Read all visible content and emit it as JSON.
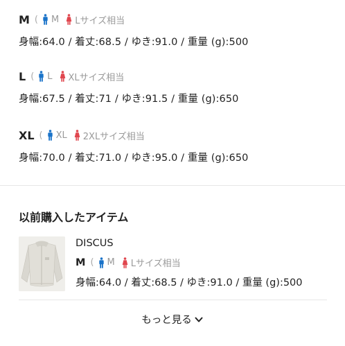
{
  "sizes": [
    {
      "name": "M",
      "open_paren": "(",
      "male_label": "M",
      "female_label": "Lサイズ相当",
      "measurements": "身幅:64.0 / 着丈:68.5 / ゆき:91.0 / 重量 (g):500"
    },
    {
      "name": "L",
      "open_paren": "(",
      "male_label": "L",
      "female_label": "XLサイズ相当",
      "measurements": "身幅:67.5 / 着丈:71 / ゆき:91.5 / 重量 (g):650"
    },
    {
      "name": "XL",
      "open_paren": "(",
      "male_label": "XL",
      "female_label": "2XLサイズ相当",
      "measurements": "身幅:70.0 / 着丈:71.0 / ゆき:95.0 / 重量 (g):650"
    }
  ],
  "purchased": {
    "title": "以前購入したアイテム",
    "item": {
      "name": "DISCUS",
      "size": "M",
      "open_paren": "(",
      "male_label": "M",
      "female_label": "Lサイズ相当",
      "measurements": "身幅:64.0 / 着丈:68.5 / ゆき:91.0 / 重量 (g):500"
    },
    "see_more": "もっと見る"
  },
  "colors": {
    "male_icon": "#1a73c9",
    "female_icon": "#e0464e"
  },
  "icons": {
    "male": "male-person-icon",
    "female": "female-person-icon",
    "chevron": "chevron-down-icon"
  }
}
